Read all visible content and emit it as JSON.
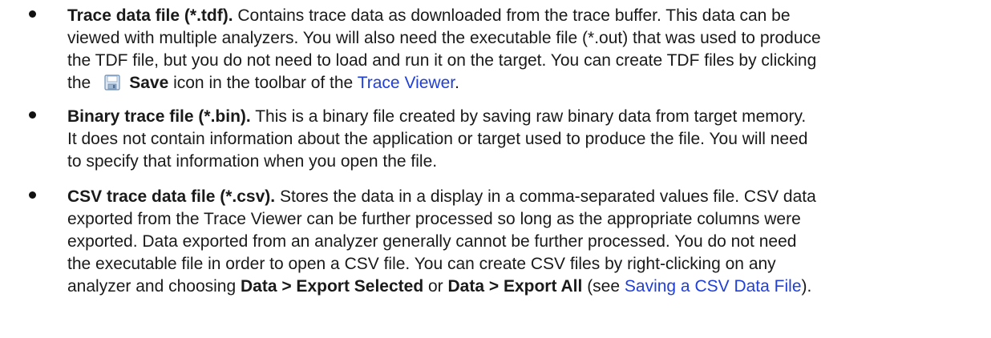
{
  "items": [
    {
      "title": "Trace data file (*.tdf).",
      "lines": [
        " Contains trace data as downloaded from the trace buffer. This data can be",
        "viewed with multiple analyzers. You will also need the executable file (*.out) that was used to produce",
        "the TDF file, but you do not need to load and run it on the target. You can create TDF files by clicking"
      ],
      "last_prefix": "the",
      "icon": "save-icon",
      "icon_label": "Save",
      "last_middle": " icon in the toolbar of the ",
      "link_text": "Trace Viewer",
      "last_suffix": "."
    },
    {
      "title": "Binary trace file (*.bin).",
      "lines": [
        " This is a binary file created by saving raw binary data from target memory.",
        "It does not contain information about the application or target used to produce the file. You will need",
        "to specify that information when you open the file."
      ]
    },
    {
      "title": "CSV trace data file (*.csv).",
      "lines": [
        " Stores the data in a display in a comma-separated values file. CSV data",
        "exported from the Trace Viewer can be further processed so long as the appropriate columns were",
        "exported. Data exported from an analyzer generally cannot be further processed. You do not need",
        "the executable file in order to open a CSV file. You can create CSV files by right-clicking on any"
      ],
      "last_prefix": "analyzer and choosing ",
      "bold_1": "Data > Export Selected",
      "or_text": " or ",
      "bold_2": "Data > Export All",
      "see_text": " (see ",
      "link_text": "Saving a CSV Data File",
      "last_suffix": ")."
    }
  ]
}
